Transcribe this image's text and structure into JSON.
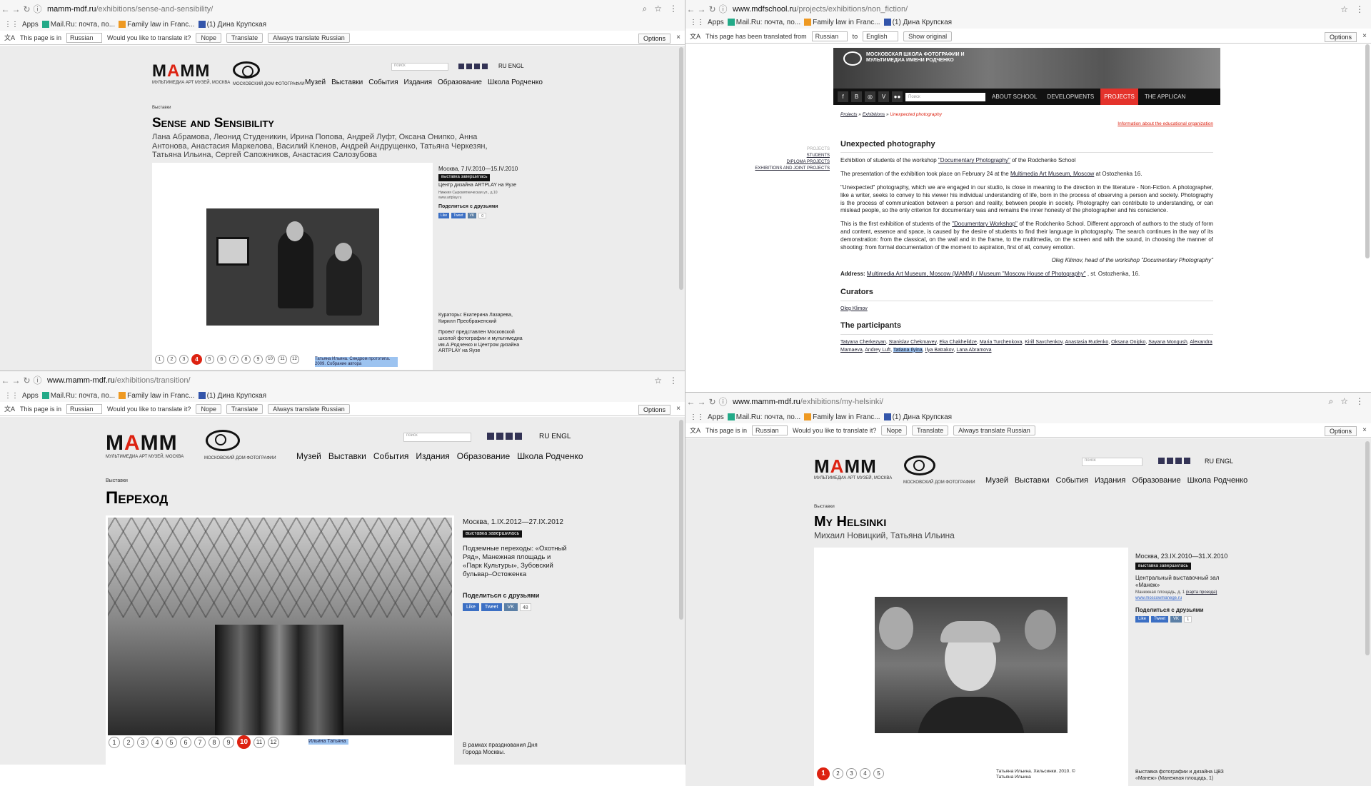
{
  "common": {
    "apps": "Apps",
    "bm_mailru": "Mail.Ru: почта, по...",
    "bm_family": "Family law in Franc...",
    "bm_fb": "(1) Дина Крупская",
    "tb_in": "This page is in",
    "tb_lang": "Russian",
    "tb_q": "Would you like to translate it?",
    "tb_nope": "Nope",
    "tb_translate": "Translate",
    "tb_always": "Always translate Russian",
    "tb_options": "Options",
    "close": "×",
    "logo_sub": "МУЛЬТИМЕДИА АРТ МУЗЕЙ, МОСКВА",
    "cam_sub": "МОСКОВСКИЙ ДОМ ФОТОГРАФИИ",
    "search": "поиск",
    "lang_ru": "RU",
    "lang_en": "ENGL",
    "menu": [
      "Музей",
      "Выставки",
      "События",
      "Издания",
      "Образование",
      "Школа Родченко"
    ],
    "crumb": "Выставки",
    "badge": "выставка завершилась",
    "share": "Поделиться с друзьями",
    "like": "Like",
    "tweet": "Tweet",
    "vk": "VK"
  },
  "q0": {
    "url_host": "mamm-mdf.ru",
    "url_path": "/exhibitions/sense-and-sensibility/",
    "title": "Sense and Sensibility",
    "authors": "Лана Абрамова, Леонид Студеникин, Ирина Попова, Андрей Луфт, Оксана Онипко, Анна Антонова, Анастасия Маркелова, Василий Кленов, Андрей Андрущенко, Татьяна Черкезян, Татьяна Ильина, Сергей Сапожников, Анастасия Салозубова",
    "date": "Москва, 7.IV.2010—15.IV.2010",
    "venue": "Центр дизайна ARTPLAY на Яузе",
    "address": "Нижняя Сыромятническая ул., д.10",
    "site": "www.artplay.ru",
    "curators": "Кураторы: Екатерина Лазарева, Кирилл Преображенский",
    "project": "Проект представлен Московской школой фотографии и мультимедиа им.А.Родченко и Центром дизайна ARTPLAY на Яузе",
    "caption": "Татьяна Ильина. Синдром прототипа. 2009. Собрание автора",
    "pages": [
      "1",
      "2",
      "3",
      "4",
      "5",
      "6",
      "7",
      "8",
      "9",
      "10",
      "11",
      "12"
    ],
    "active": "4",
    "share_count": "0"
  },
  "q1": {
    "url_host": "www.mdfschool.ru",
    "url_path": "/projects/exhibitions/non_fiction/",
    "tb_translated": "This page has been translated from",
    "tb_from": "Russian",
    "tb_to_word": "to",
    "tb_to": "English",
    "tb_show": "Show original",
    "banner_title": "МОСКОВСКАЯ ШКОЛА ФОТОГРАФИИ И МУЛЬТИМЕДИА ИМЕНИ РОДЧЕНКО",
    "search": "Поиск",
    "nav": [
      "ABOUT SCHOOL",
      "DEVELOPMENTS",
      "PROJECTS",
      "THE APPLICAN"
    ],
    "crumb": [
      "Projects",
      "Exhibitions",
      "Unexpected photography"
    ],
    "info_link": "Information about the educational organization",
    "left_menu": [
      "PROJECTS",
      "STUDENTS",
      "DIPLOMA PROJECTS",
      "EXHIBITIONS AND JOINT PROJECTS"
    ],
    "h1": "Unexpected photography",
    "p1a": "Exhibition of students of the workshop ",
    "p1link": "\"Documentary Photography\"",
    "p1b": " of the Rodchenko School",
    "p2a": "The presentation of the exhibition took place on February 24 at the ",
    "p2link": "Multimedia Art Museum, Moscow",
    "p2b": " at Ostozhenka 16.",
    "p3": "\"Unexpected\" photography, which we are engaged in our studio, is close in meaning to the direction in the literature - Non-Fiction. A photographer, like a writer, seeks to convey to his viewer his individual understanding of life, born in the process of observing a person and society. Photography is the process of communication between a person and reality, between people in society. Photography can contribute to understanding, or can mislead people, so the only criterion for documentary was and remains the inner honesty of the photographer and his conscience.",
    "p4a": "This is the first exhibition of students of the ",
    "p4link": "\"Documentary Workshop\"",
    "p4b": " of the Rodchenko School. Different approach of authors to the study of form and content, essence and space, is caused by the desire of students to find their language in photography. The search continues in the way of its demonstration: from the classical, on the wall and in the frame, to the multimedia, on the screen and with the sound, in choosing the manner of shooting: from formal documentation of the moment to aspiration, first of all, convey emotion.",
    "quote": "Oleg Klimov, head of the workshop \"Documentary Photography\"",
    "addr_label": "Address:",
    "addr_link": "Multimedia Art Museum, Moscow (MAMM) / Museum \"Moscow House of Photography\"",
    "addr_rest": " , st. Ostozhenka, 16.",
    "h_curators": "Curators",
    "curator": "Oleg Klimov",
    "h_participants": "The participants",
    "participants": [
      "Tatyana Cherkezyan",
      "Stanislav Chekmavey",
      "Eka Chakhelidze",
      "Maria Turchenkova",
      "Kirill Savchenkov",
      "Anastasia Rudenko",
      "Oksana Onipko",
      "Sayana Mongush",
      "Alexandra Mamaeva",
      "Andrey Luft",
      "Tatiana Ilyina",
      "Ilya Batrakov",
      "Lana Abramova"
    ]
  },
  "q2": {
    "url_host": "www.mamm-mdf.ru",
    "url_path": "/exhibitions/transition/",
    "title": "Переход",
    "date": "Москва, 1.IX.2012—27.IX.2012",
    "venue": "Подземные переходы: «Охотный Ряд», Манежная площадь и «Парк Культуры», Зубовский бульвар–Остоженка",
    "share_count": "48",
    "note": "В рамках празднования Дня Города Москвы.",
    "caption": "Ильина Татьяна",
    "pages": [
      "1",
      "2",
      "3",
      "4",
      "5",
      "6",
      "7",
      "8",
      "9",
      "10",
      "11",
      "12"
    ],
    "active": "10"
  },
  "q3": {
    "url_host": "www.mamm-mdf.ru",
    "url_path": "/exhibitions/my-helsinki/",
    "title": "My Helsinki",
    "authors": "Михаил Новицкий, Татьяна Ильина",
    "date": "Москва, 23.IX.2010—31.X.2010",
    "venue": "Центральный выставочный зал «Манеж»",
    "address": "Манежная площадь, д. 1",
    "map": "(карта проезда)",
    "site": "www.moscowmanege.ru",
    "caption": "Татьяна Ильина. Хельсинки. 2010. © Татьяна Ильина",
    "note": "Выставка фотографии и дизайна ЦВЗ «Манеж» (Манежная площадь, 1)",
    "pages": [
      "1",
      "2",
      "3",
      "4",
      "5"
    ],
    "active": "1",
    "share_count": "1"
  },
  "icons": [
    "back-arrow-icon",
    "forward-arrow-icon",
    "reload-icon",
    "info-icon",
    "search-icon",
    "star-icon",
    "menu-dots-icon",
    "translate-icon",
    "close-icon",
    "camera-logo-icon",
    "facebook-icon",
    "twitter-icon",
    "vk-icon",
    "instagram-icon"
  ],
  "colors": {
    "accent_red": "#d21f1f",
    "projects_red": "#e4322b",
    "page_bg": "#ececec",
    "share_blue": "#3b6fc4",
    "highlight": "#9cc3f0"
  }
}
